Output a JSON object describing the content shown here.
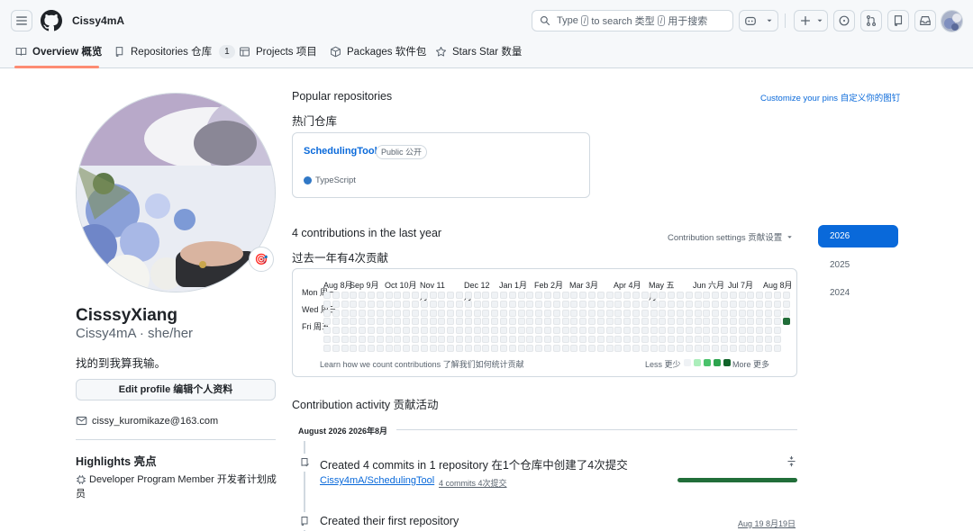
{
  "header": {
    "username": "Cissy4mA",
    "search_prefix": "Type",
    "search_key": "/",
    "search_mid": "to search 类型",
    "search_key2": "/",
    "search_suffix": "用于搜索"
  },
  "tabs": [
    {
      "label": "Overview 概览",
      "active": true
    },
    {
      "label": "Repositories 仓库",
      "count": "1"
    },
    {
      "label": "Projects 项目"
    },
    {
      "label": "Packages 软件包"
    },
    {
      "label": "Stars Star 数量"
    }
  ],
  "profile": {
    "full_name": "CisssyXiang",
    "handle": "Cissy4mA · she/her",
    "bio": "找的到我算我输。",
    "edit_label": "Edit profile 编辑个人资料",
    "email": "cissy_kuromikaze@163.com",
    "status_emoji": "🎯"
  },
  "highlights": {
    "title": "Highlights 亮点",
    "item": "Developer Program Member  开发者计划成员"
  },
  "popular": {
    "title_en": "Popular repositories",
    "title_zh": "热门仓库",
    "customize": "Customize your pins 自定义你的图钉",
    "repo_name": "SchedulingTool",
    "visibility": "Public 公开",
    "language": "TypeScript",
    "language_color": "#3178c6"
  },
  "contributions": {
    "title_en": "4 contributions in the last year",
    "title_zh": "过去一年有4次贡献",
    "settings": "Contribution settings 贡献设置",
    "months": [
      "Aug 8月",
      "Sep 9月",
      "Oct 10月",
      "Nov 11月",
      "Dec 12月",
      "Jan 1月",
      "Feb 2月",
      "Mar 3月",
      "Apr 4月",
      "May 五月",
      "Jun 六月",
      "Jul 7月",
      "Aug 8月"
    ],
    "day_mon": "Mon 周一",
    "day_wed": "Wed 周三",
    "day_fri": "Fri 周五",
    "learn": "Learn how we count contributions 了解我们如何统计贡献",
    "less": "Less 更少",
    "more": "More 更多",
    "active_color": "#216e39",
    "empty_color": "#eff2f5",
    "legend_colors": [
      "#eff2f5",
      "#aceebb",
      "#4ac26b",
      "#2da44e",
      "#116329"
    ]
  },
  "years": [
    "2026",
    "2025",
    "2024"
  ],
  "activity": {
    "title": "Contribution activity  贡献活动",
    "month": "August 2026  2026年8月",
    "commit_title": "Created 4 commits in 1 repository  在1个仓库中创建了4次提交",
    "commit_repo": "Cissy4mA/SchedulingTool",
    "commit_count": "4 commits  4次提交",
    "repo_title": "Created their first repository",
    "repo_date": "Aug 19  8月19日"
  }
}
